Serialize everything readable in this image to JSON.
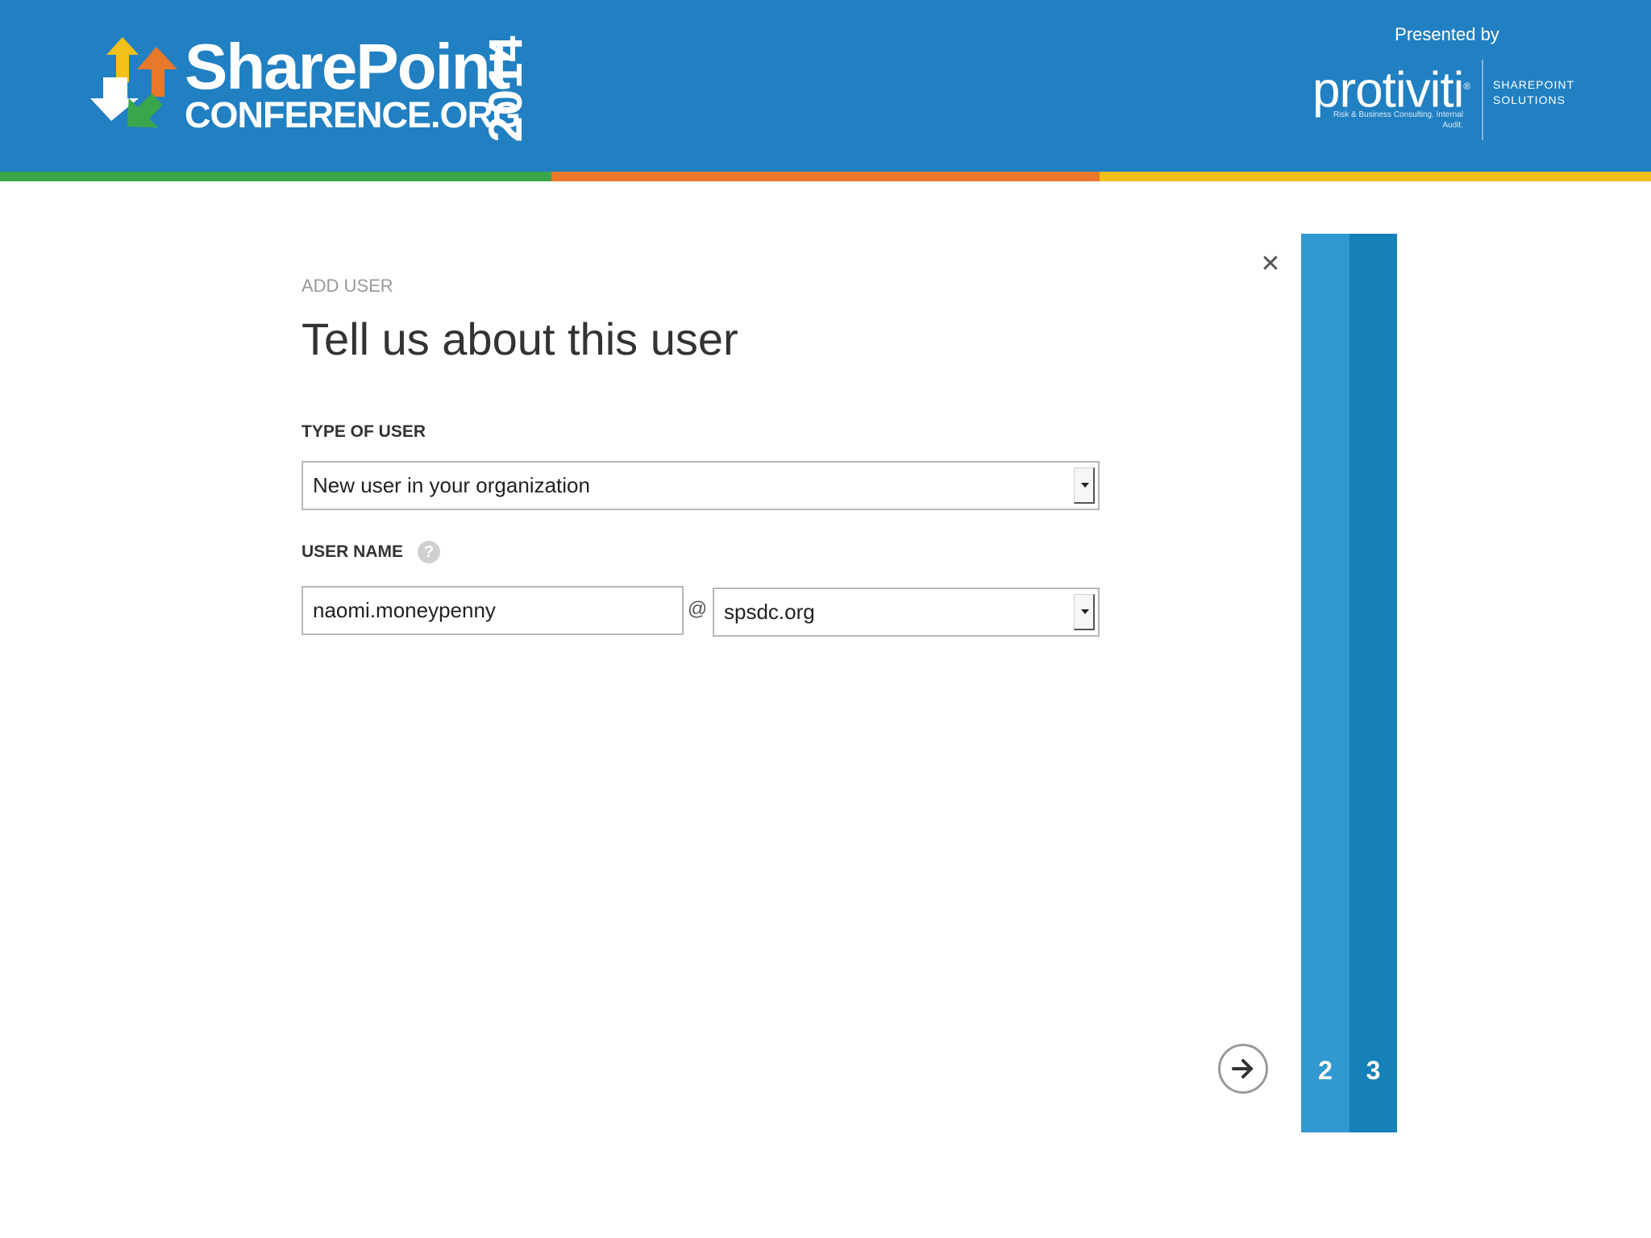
{
  "colors": {
    "banner": "#2180c2",
    "stripe_green": "#3aa64c",
    "stripe_orange": "#e8782a",
    "stripe_yellow": "#f2c019",
    "step_2": "#3299d0",
    "step_3": "#1680b8"
  },
  "header": {
    "logo_title": "SharePoint",
    "logo_sub": "CONFERENCE.ORG",
    "logo_year": "2014",
    "logo_icon": "sharepoint-arrows-logo",
    "presented_by": "Presented by",
    "sponsor_name": "protiviti",
    "sponsor_mark": "®",
    "sponsor_tagline": "Risk & Business Consulting. Internal Audit.",
    "sponsor_division_line1": "SHAREPOINT",
    "sponsor_division_line2": "SOLUTIONS"
  },
  "dialog": {
    "eyebrow": "ADD USER",
    "title": "Tell us about this user",
    "close_icon": "close-icon",
    "type_of_user": {
      "label": "TYPE OF USER",
      "value": "New user in your organization"
    },
    "user_name": {
      "label": "USER NAME",
      "help_symbol": "?",
      "value": "naomi.moneypenny",
      "at": "@",
      "domain": "spsdc.org"
    },
    "next_icon": "arrow-right-icon"
  },
  "steps": [
    {
      "number": "2"
    },
    {
      "number": "3"
    }
  ]
}
